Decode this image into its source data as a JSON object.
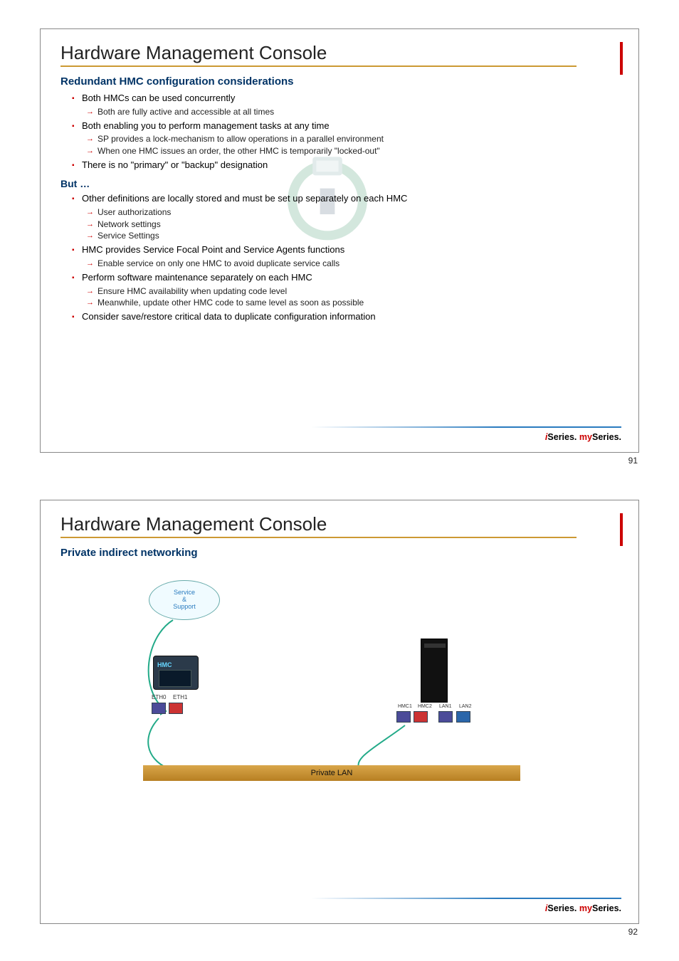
{
  "slide1": {
    "title": "Hardware Management Console",
    "section_heading": "Redundant HMC configuration considerations",
    "group_a": [
      {
        "text": "Both HMCs can be used concurrently",
        "sub": [
          "Both are fully active and accessible at all times"
        ]
      },
      {
        "text": "Both enabling you to perform management tasks at any time",
        "sub": [
          "SP provides a lock-mechanism to allow operations in a parallel environment",
          "When one HMC issues an order, the other HMC is temporarily \"locked-out\""
        ]
      },
      {
        "text": "There is no \"primary\" or \"backup\" designation",
        "sub": []
      }
    ],
    "but_heading": "But …",
    "group_b": [
      {
        "text": "Other definitions are locally stored and must be set up separately on each HMC",
        "sub": [
          "User authorizations",
          "Network settings",
          "Service Settings"
        ]
      },
      {
        "text": "HMC provides Service Focal Point and Service Agents functions",
        "sub": [
          "Enable service on only one HMC to avoid duplicate service calls"
        ]
      },
      {
        "text": "Perform software maintenance separately on each HMC",
        "sub": [
          "Ensure HMC availability when updating code level",
          "Meanwhile, update other HMC code to same level as soon as possible"
        ]
      },
      {
        "text": "Consider save/restore critical data to duplicate configuration information",
        "sub": []
      }
    ],
    "page": "91"
  },
  "slide2": {
    "title": "Hardware Management Console",
    "section_heading": "Private indirect networking",
    "cloud": "Service\n&\nSupport",
    "hmc": "HMC",
    "eth0": "ETH0",
    "eth1": "ETH1",
    "hmc1": "HMC1",
    "hmc2": "HMC2",
    "lan1": "LAN1",
    "lan2": "LAN2",
    "lan_bar": "Private LAN",
    "page": "92"
  },
  "footer": {
    "i": "i",
    "series": "Series.",
    "my": "my",
    "series2": "Series."
  }
}
